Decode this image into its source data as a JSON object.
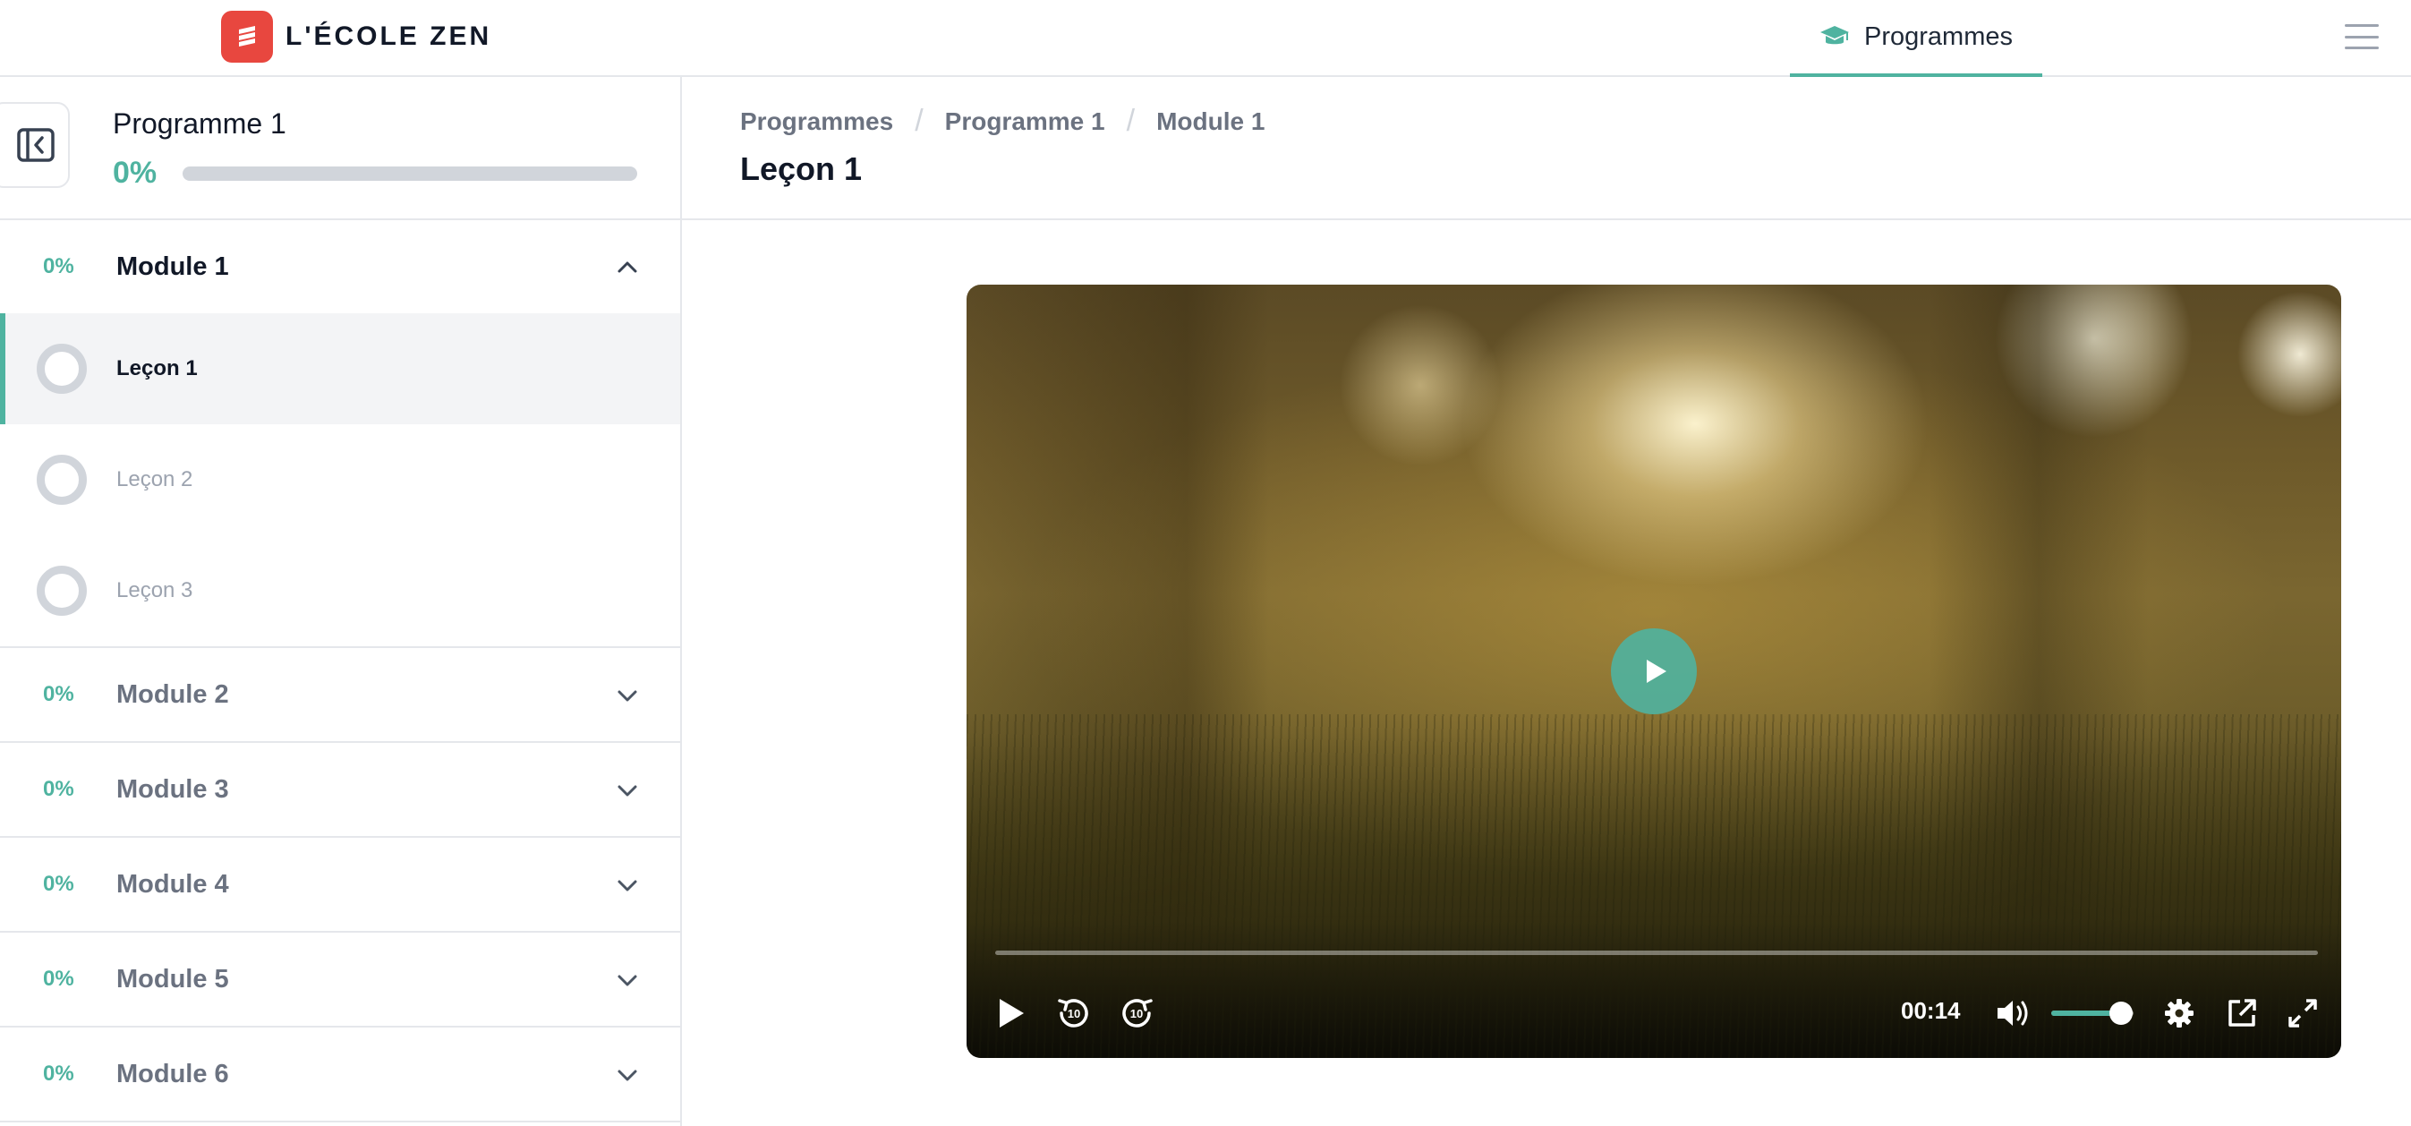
{
  "brand": {
    "name": "L'ÉCOLE ZEN",
    "accent": "#4fb3a0",
    "logo_color": "#e8473f"
  },
  "topnav": {
    "tab_label": "Programmes",
    "tab_icon": "graduation-cap-icon"
  },
  "sidebar": {
    "program_title": "Programme 1",
    "program_progress_label": "0%",
    "program_progress": 0,
    "modules": [
      {
        "title": "Module 1",
        "progress": "0%",
        "expanded": true,
        "lessons": [
          {
            "label": "Leçon 1",
            "active": true
          },
          {
            "label": "Leçon 2",
            "active": false
          },
          {
            "label": "Leçon 3",
            "active": false
          }
        ]
      },
      {
        "title": "Module 2",
        "progress": "0%",
        "expanded": false
      },
      {
        "title": "Module 3",
        "progress": "0%",
        "expanded": false
      },
      {
        "title": "Module 4",
        "progress": "0%",
        "expanded": false
      },
      {
        "title": "Module 5",
        "progress": "0%",
        "expanded": false
      },
      {
        "title": "Module 6",
        "progress": "0%",
        "expanded": false
      }
    ]
  },
  "main": {
    "breadcrumb": [
      "Programmes",
      "Programme 1",
      "Module 1"
    ],
    "title": "Leçon 1"
  },
  "video": {
    "time": "00:14",
    "seek_progress": 0,
    "volume": 0.85,
    "rewind_seconds": "10",
    "forward_seconds": "10"
  }
}
